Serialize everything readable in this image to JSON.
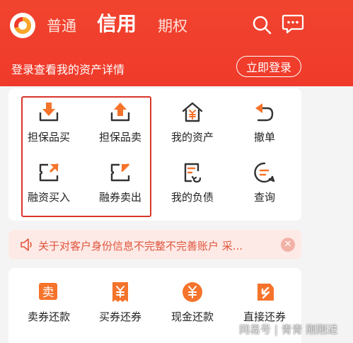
{
  "header": {
    "tabs": [
      {
        "label": "普通"
      },
      {
        "label": "信用"
      },
      {
        "label": "期权"
      }
    ],
    "login_prompt": "登录查看我的资产详情",
    "login_button": "立即登录"
  },
  "grid": {
    "items": [
      {
        "label": "担保品买",
        "icon": "download-tray-icon"
      },
      {
        "label": "担保品卖",
        "icon": "upload-tray-icon"
      },
      {
        "label": "我的资产",
        "icon": "house-yen-icon"
      },
      {
        "label": "撤单",
        "icon": "undo-arrow-icon"
      },
      {
        "label": "融资买入",
        "icon": "finance-buy-icon"
      },
      {
        "label": "融券卖出",
        "icon": "securities-sell-icon"
      },
      {
        "label": "我的负债",
        "icon": "liability-document-icon"
      },
      {
        "label": "查询",
        "icon": "search-chat-icon"
      }
    ]
  },
  "notice": {
    "text": "关于对客户身份信息不完整不完善账户 采...",
    "icon": "speaker-icon"
  },
  "repay": {
    "items": [
      {
        "label": "卖券还款",
        "icon": "sell-stamp-icon"
      },
      {
        "label": "买券还券",
        "icon": "yen-receipt-icon"
      },
      {
        "label": "现金还款",
        "icon": "yen-coin-icon"
      },
      {
        "label": "直接还券",
        "icon": "direct-return-icon"
      }
    ]
  },
  "watermark": "网易号 | 青青 刚刚进",
  "colors": {
    "brand_red": "#ef3a2a",
    "icon_orange": "#f5732b",
    "notice_bg": "#fdeae6",
    "notice_text": "#e0543d"
  }
}
